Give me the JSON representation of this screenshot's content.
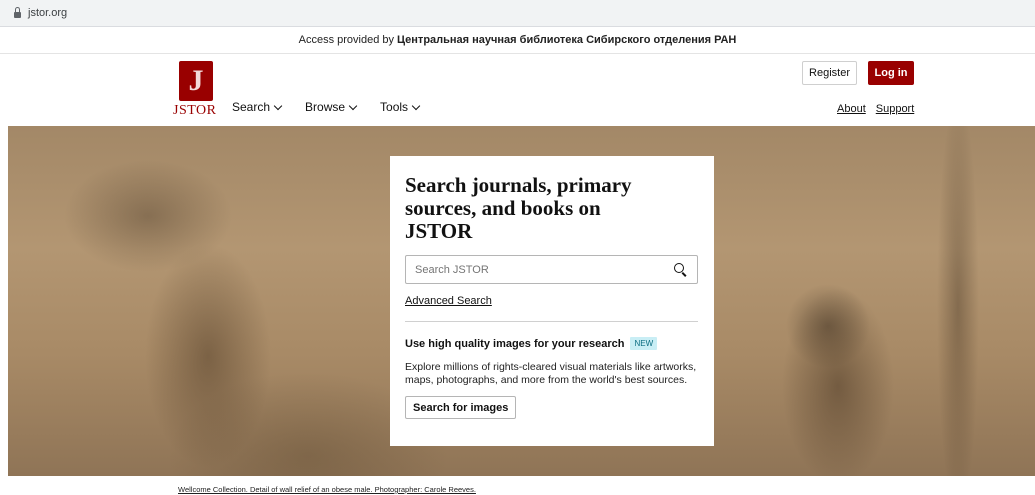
{
  "browser": {
    "url": "jstor.org"
  },
  "access": {
    "prefix": "Access provided by",
    "institution": "Центральная научная библиотека Сибирского отделения РАН"
  },
  "header": {
    "logo_glyph": "J",
    "logo_text": "JSTOR",
    "nav": [
      {
        "label": "Search"
      },
      {
        "label": "Browse"
      },
      {
        "label": "Tools"
      }
    ],
    "register_label": "Register",
    "login_label": "Log in",
    "about_label": "About",
    "support_label": "Support"
  },
  "hero": {
    "title": "Search journals, primary sources, and books on JSTOR",
    "search_placeholder": "Search JSTOR",
    "advanced_label": "Advanced Search",
    "images_heading": "Use high quality images for your research",
    "new_badge": "NEW",
    "images_desc": "Explore millions of rights-cleared visual materials like artworks, maps, photographs, and more from the world's best sources.",
    "images_button": "Search for images"
  },
  "caption": "Wellcome Collection. Detail of wall relief of an obese male. Photographer: Carole Reeves.",
  "colors": {
    "brand": "#990000",
    "new_badge_bg": "#c9eef5"
  },
  "icons": [
    "lock-icon",
    "chevron-down-icon",
    "search-icon"
  ]
}
